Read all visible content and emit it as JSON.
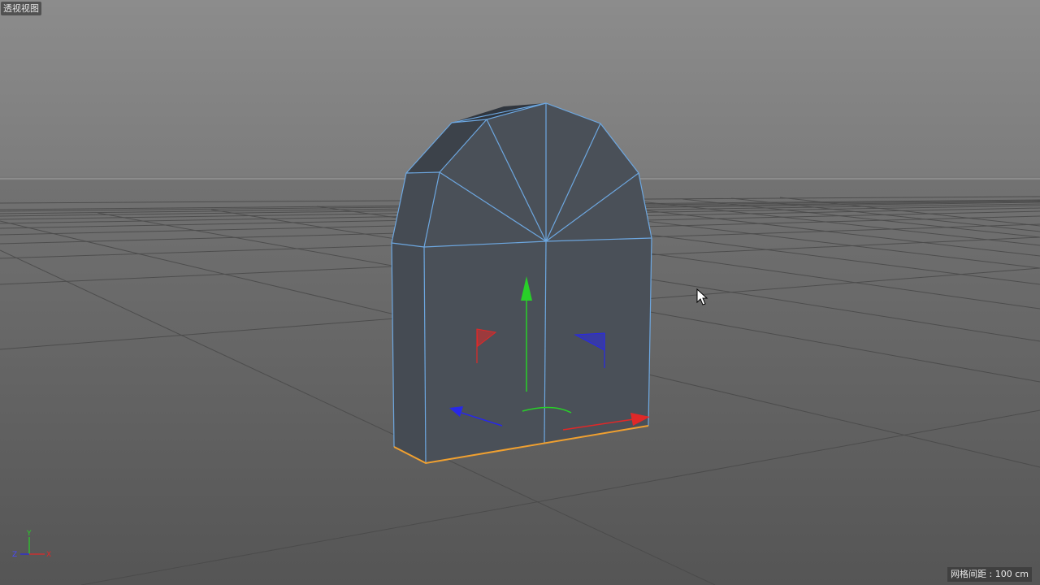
{
  "viewport": {
    "view_name": "透视视图",
    "grid_spacing_label": "网格间距 : 100 cm"
  },
  "axis_indicator": {
    "y_label": "Y",
    "x_label": "X",
    "z_label": "Z"
  },
  "colors": {
    "mesh_face": "#4a5058",
    "mesh_edge": "#6da7e0",
    "selected_edge": "#f0a030",
    "axis_x": "#e02828",
    "axis_y": "#28d028",
    "axis_z": "#2828e8"
  },
  "cursor": {
    "icon": "arrow-cursor-icon"
  }
}
